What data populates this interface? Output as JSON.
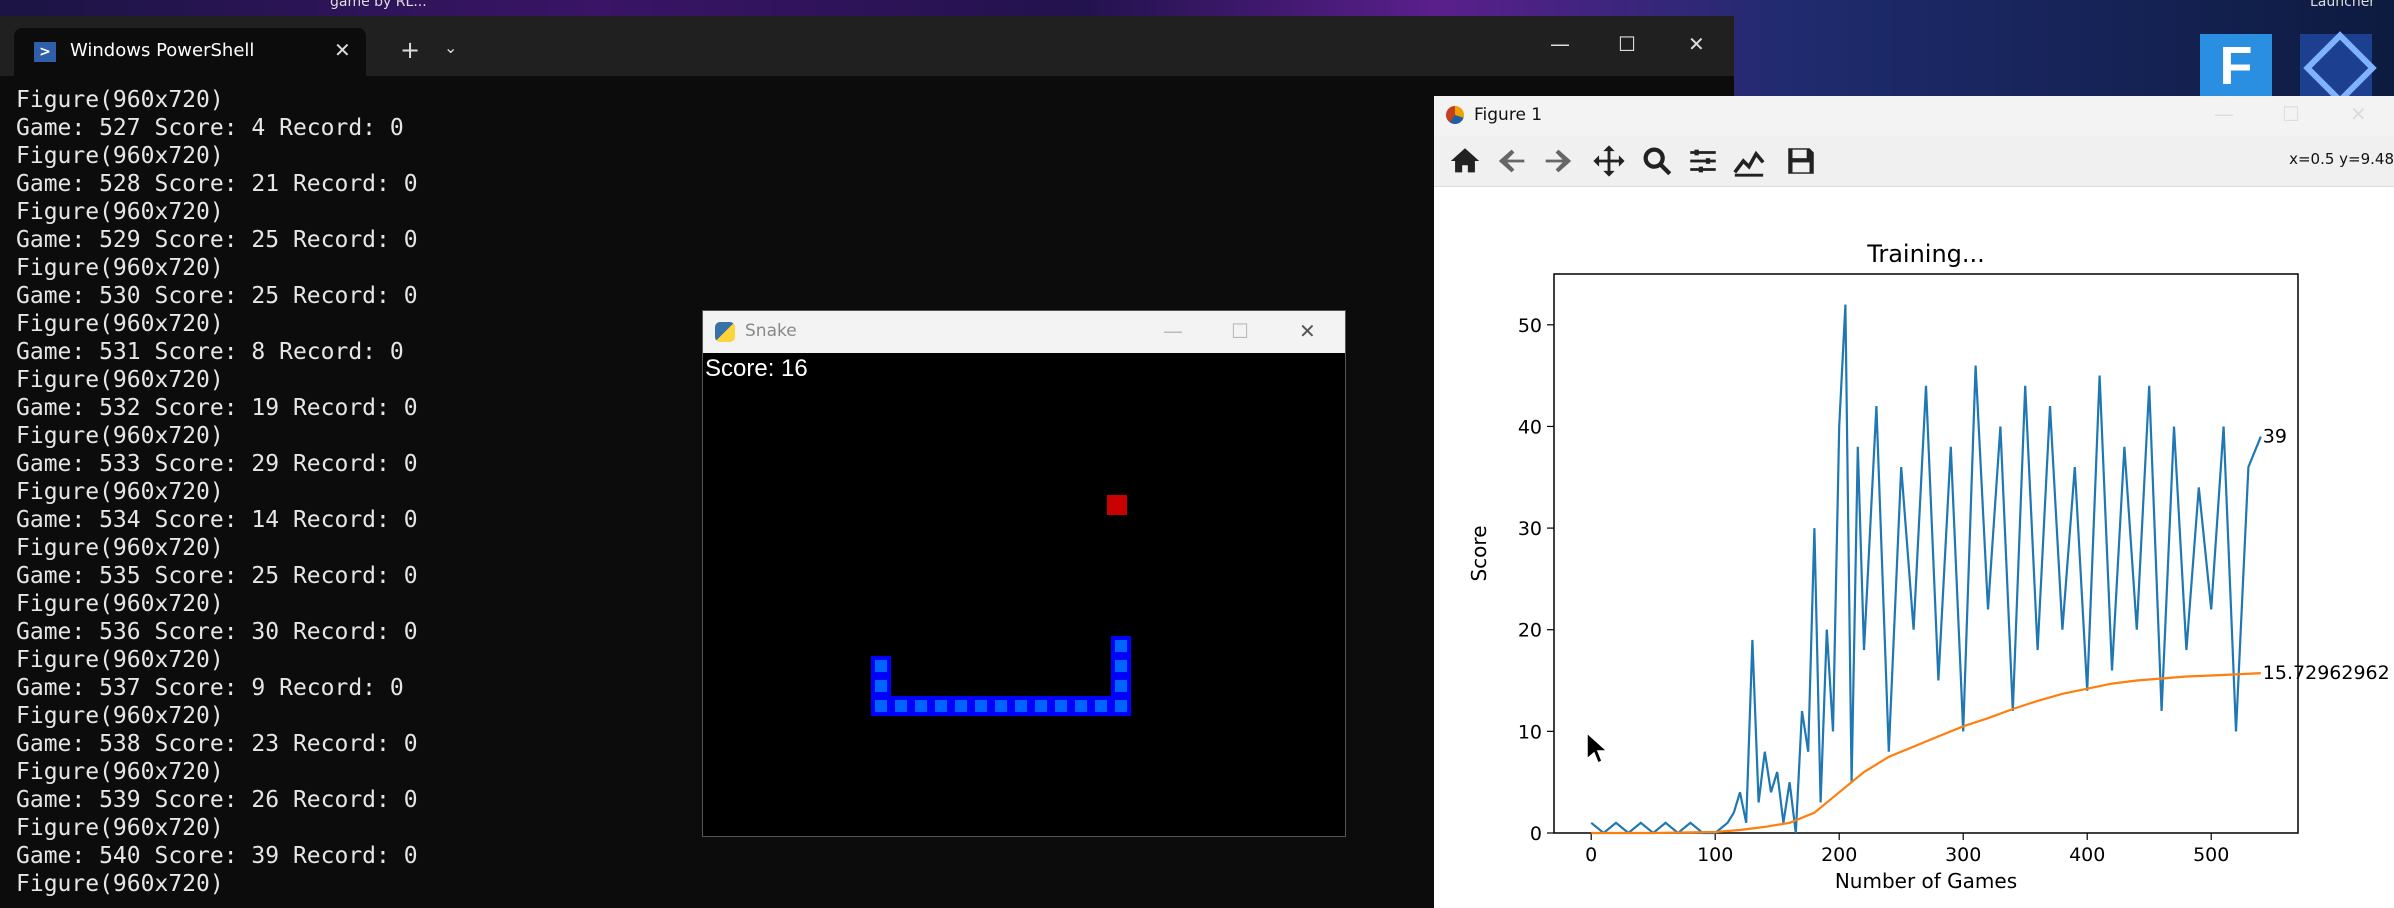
{
  "desktop": {
    "caption_left": "game by RL...",
    "caption_right": "Launcher",
    "icon_f_letter": "F"
  },
  "terminal": {
    "tab_title": "Windows PowerShell",
    "new_tab_label": "+",
    "close_label": "✕",
    "dropdown_label": "⌄",
    "minimize": "—",
    "maximize": "☐",
    "close": "✕",
    "lines": [
      "Figure(960x720)",
      "Game: 527 Score: 4 Record: 0",
      "Figure(960x720)",
      "Game: 528 Score: 21 Record: 0",
      "Figure(960x720)",
      "Game: 529 Score: 25 Record: 0",
      "Figure(960x720)",
      "Game: 530 Score: 25 Record: 0",
      "Figure(960x720)",
      "Game: 531 Score: 8 Record: 0",
      "Figure(960x720)",
      "Game: 532 Score: 19 Record: 0",
      "Figure(960x720)",
      "Game: 533 Score: 29 Record: 0",
      "Figure(960x720)",
      "Game: 534 Score: 14 Record: 0",
      "Figure(960x720)",
      "Game: 535 Score: 25 Record: 0",
      "Figure(960x720)",
      "Game: 536 Score: 30 Record: 0",
      "Figure(960x720)",
      "Game: 537 Score: 9 Record: 0",
      "Figure(960x720)",
      "Game: 538 Score: 23 Record: 0",
      "Figure(960x720)",
      "Game: 539 Score: 26 Record: 0",
      "Figure(960x720)",
      "Game: 540 Score: 39 Record: 0",
      "Figure(960x720)"
    ]
  },
  "snake_window": {
    "title": "Snake",
    "minimize": "—",
    "maximize": "☐",
    "close": "✕",
    "score_label": "Score: 16"
  },
  "figure_window": {
    "title": "Figure 1",
    "minimize": "—",
    "maximize": "☐",
    "close": "✕",
    "coord_readout": "x=0.5 y=9.48",
    "toolbar_icons": [
      "home-icon",
      "back-arrow-icon",
      "forward-arrow-icon",
      "pan-icon",
      "zoom-icon",
      "subplots-icon",
      "customize-icon",
      "save-icon"
    ]
  },
  "chart_data": {
    "type": "line",
    "title": "Training...",
    "xlabel": "Number of Games",
    "ylabel": "Score",
    "xlim": [
      -30,
      570
    ],
    "ylim": [
      0,
      55
    ],
    "xticks": [
      0,
      100,
      200,
      300,
      400,
      500
    ],
    "yticks": [
      0,
      10,
      20,
      30,
      40,
      50
    ],
    "last_score_label": "39",
    "last_mean_label": "15.72962962",
    "series": [
      {
        "color": "#1f77b4",
        "x": [
          0,
          10,
          20,
          30,
          40,
          50,
          60,
          70,
          80,
          90,
          100,
          110,
          115,
          120,
          125,
          130,
          135,
          140,
          145,
          150,
          155,
          160,
          165,
          170,
          175,
          180,
          185,
          190,
          195,
          200,
          205,
          210,
          215,
          220,
          230,
          240,
          250,
          260,
          270,
          280,
          290,
          300,
          310,
          320,
          330,
          340,
          350,
          360,
          370,
          380,
          390,
          400,
          410,
          420,
          430,
          440,
          450,
          460,
          470,
          480,
          490,
          500,
          510,
          520,
          530,
          540
        ],
        "values": [
          1,
          0,
          1,
          0,
          1,
          0,
          1,
          0,
          1,
          0,
          0,
          1,
          2,
          4,
          1,
          19,
          3,
          8,
          4,
          6,
          1,
          5,
          0,
          12,
          8,
          30,
          3,
          20,
          10,
          40,
          52,
          5,
          38,
          18,
          42,
          8,
          36,
          20,
          44,
          15,
          38,
          10,
          46,
          22,
          40,
          12,
          44,
          18,
          42,
          20,
          36,
          14,
          45,
          16,
          38,
          20,
          44,
          12,
          40,
          18,
          34,
          22,
          40,
          10,
          36,
          39
        ]
      },
      {
        "color": "#ff7f0e",
        "x": [
          0,
          50,
          100,
          120,
          140,
          160,
          180,
          200,
          220,
          240,
          260,
          280,
          300,
          320,
          340,
          360,
          380,
          400,
          420,
          440,
          460,
          480,
          500,
          520,
          540
        ],
        "values": [
          0,
          0,
          0.1,
          0.3,
          0.6,
          1,
          2,
          4,
          6,
          7.5,
          8.5,
          9.5,
          10.5,
          11.3,
          12.2,
          13,
          13.7,
          14.2,
          14.7,
          15,
          15.2,
          15.4,
          15.5,
          15.6,
          15.73
        ]
      }
    ]
  }
}
